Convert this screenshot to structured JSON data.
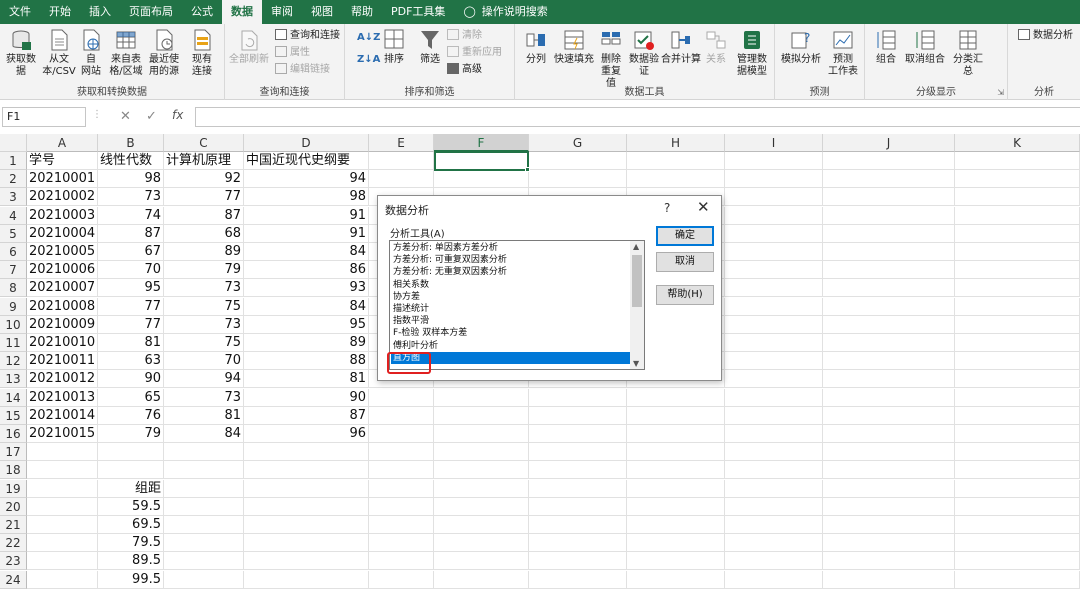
{
  "ribbon_tabs": [
    "文件",
    "开始",
    "插入",
    "页面布局",
    "公式",
    "数据",
    "审阅",
    "视图",
    "帮助",
    "PDF工具集",
    "操作说明搜索"
  ],
  "active_tab": "数据",
  "groups": {
    "get": {
      "label": "获取和转换数据",
      "btn1": "获取数",
      "btn1b": "据",
      "btn2": "从文",
      "btn2b": "本/CSV",
      "btn3": "自",
      "btn3b": "网站",
      "btn4": "来自表",
      "btn4b": "格/区域",
      "btn5": "最近使",
      "btn5b": "用的源",
      "btn6": "现有",
      "btn6b": "连接"
    },
    "query": {
      "label": "查询和连接",
      "refresh": "全部刷新",
      "item1": "查询和连接",
      "item2": "属性",
      "item3": "编辑链接"
    },
    "sort": {
      "label": "排序和筛选",
      "sort": "排序",
      "filter": "筛选",
      "clear": "清除",
      "reapply": "重新应用",
      "advanced": "高级"
    },
    "tools": {
      "label": "数据工具",
      "split": "分列",
      "flash": "快速填充",
      "dup1": "删除",
      "dup2": "重复值",
      "valid1": "数据验",
      "valid2": "证",
      "consolidate": "合并计算",
      "relations": "关系",
      "model1": "管理数",
      "model2": "据模型"
    },
    "forecast": {
      "label": "预测",
      "whatif": "模拟分析",
      "sheet1": "预测",
      "sheet2": "工作表"
    },
    "outline": {
      "label": "分级显示",
      "group": "组合",
      "ungroup": "取消组合",
      "subtotal": "分类汇总"
    },
    "analysis": {
      "label": "分析",
      "btn": "数据分析"
    }
  },
  "formula_bar": {
    "namebox": "F1",
    "fx": "fx",
    "content": ""
  },
  "columns": [
    "A",
    "B",
    "C",
    "D",
    "E",
    "F",
    "G",
    "H",
    "I",
    "J",
    "K"
  ],
  "rows": [
    "1",
    "2",
    "3",
    "4",
    "5",
    "6",
    "7",
    "8",
    "9",
    "10",
    "11",
    "12",
    "13",
    "14",
    "15",
    "16",
    "17",
    "18",
    "19",
    "20",
    "21",
    "22",
    "23",
    "24"
  ],
  "headers": [
    "学号",
    "线性代数",
    "计算机原理",
    "中国近现代史纲要"
  ],
  "table": [
    [
      "20210001",
      "98",
      "92",
      "94"
    ],
    [
      "20210002",
      "73",
      "77",
      "98"
    ],
    [
      "20210003",
      "74",
      "87",
      "91"
    ],
    [
      "20210004",
      "87",
      "68",
      "91"
    ],
    [
      "20210005",
      "67",
      "89",
      "84"
    ],
    [
      "20210006",
      "70",
      "79",
      "86"
    ],
    [
      "20210007",
      "95",
      "73",
      "93"
    ],
    [
      "20210008",
      "77",
      "75",
      "84"
    ],
    [
      "20210009",
      "77",
      "73",
      "95"
    ],
    [
      "20210010",
      "81",
      "75",
      "89"
    ],
    [
      "20210011",
      "63",
      "70",
      "88"
    ],
    [
      "20210012",
      "90",
      "94",
      "81"
    ],
    [
      "20210013",
      "65",
      "73",
      "90"
    ],
    [
      "20210014",
      "76",
      "81",
      "87"
    ],
    [
      "20210015",
      "79",
      "84",
      "96"
    ]
  ],
  "bins_label": "组距",
  "bins": [
    "59.5",
    "69.5",
    "79.5",
    "89.5",
    "99.5"
  ],
  "dialog": {
    "title": "数据分析",
    "help_glyph": "?",
    "close_glyph": "✕",
    "list_label": "分析工具(A)",
    "items": [
      "方差分析: 单因素方差分析",
      "方差分析: 可重复双因素分析",
      "方差分析: 无重复双因素分析",
      "相关系数",
      "协方差",
      "描述统计",
      "指数平滑",
      "F-检验 双样本方差",
      "傅利叶分析",
      "直方图"
    ],
    "selected_item": "直方图",
    "ok": "确定",
    "cancel": "取消",
    "help": "帮助(H)"
  },
  "colors": {
    "excel_green": "#217346",
    "selection_blue": "#0078d7",
    "highlight_red": "#e02020"
  }
}
